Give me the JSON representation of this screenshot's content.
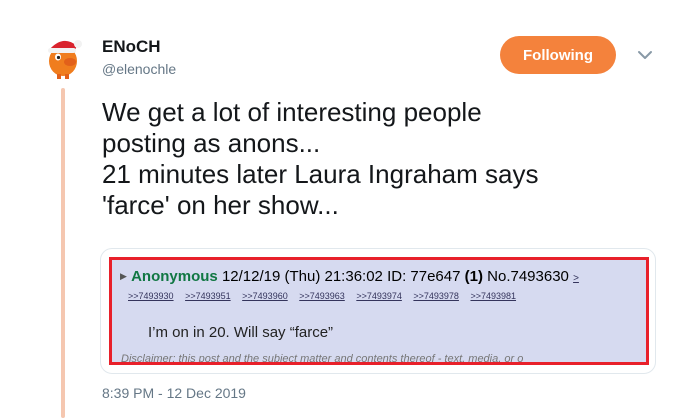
{
  "author": {
    "display_name": "ENoCH",
    "handle": "@elenochle",
    "avatar_icon": "orange-character-with-santa-hat-icon"
  },
  "follow_button": {
    "label": "Following",
    "color": "#f4823c"
  },
  "menu_icon": "chevron-down-icon",
  "tweet": {
    "lines": [
      "We get a lot of interesting people",
      "posting as anons...",
      "21 minutes later Laura Ingraham says",
      "'farce' on her show..."
    ],
    "timestamp": "8:39 PM - 12 Dec 2019"
  },
  "media": {
    "header": {
      "name": "Anonymous",
      "datetime": "12/12/19 (Thu) 21:36:02",
      "id": "ID: 77e647",
      "id_count": "(1)",
      "post_no": "No.7493630",
      "fwd": ">"
    },
    "backlinks": [
      ">>7493930",
      ">>7493951",
      ">>7493960",
      ">>7493963",
      ">>7493974",
      ">>7493978",
      ">>7493981"
    ],
    "body": "I’m on in 20.  Will say “farce”",
    "disclaimer": "Disclaimer: this post and the subject matter and contents thereof - text, media, or o"
  }
}
